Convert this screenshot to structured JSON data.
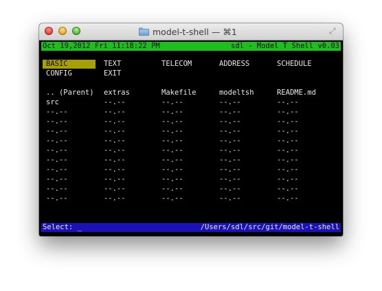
{
  "window": {
    "title": "model-t-shell — ⌘1"
  },
  "top_bar": {
    "datetime": "Oct 19,2012 Fri 11:18:22 PM",
    "app": "sdl - Model T Shell v0.03"
  },
  "menu": [
    [
      "BASIC",
      "TEXT",
      "TELECOM",
      "ADDRESS",
      "SCHEDULE"
    ],
    [
      "CONFIG",
      "EXIT",
      "",
      "",
      ""
    ]
  ],
  "selected_menu": "BASIC",
  "files": [
    [
      ".. (Parent)",
      "extras",
      "Makefile",
      "modeltsh",
      "README.md"
    ],
    [
      "src",
      "--.--",
      "--.--",
      "--.--",
      "--.--"
    ],
    [
      "--.--",
      "--.--",
      "--.--",
      "--.--",
      "--.--"
    ],
    [
      "--.--",
      "--.--",
      "--.--",
      "--.--",
      "--.--"
    ],
    [
      "--.--",
      "--.--",
      "--.--",
      "--.--",
      "--.--"
    ],
    [
      "--.--",
      "--.--",
      "--.--",
      "--.--",
      "--.--"
    ],
    [
      "--.--",
      "--.--",
      "--.--",
      "--.--",
      "--.--"
    ],
    [
      "--.--",
      "--.--",
      "--.--",
      "--.--",
      "--.--"
    ],
    [
      "--.--",
      "--.--",
      "--.--",
      "--.--",
      "--.--"
    ],
    [
      "--.--",
      "--.--",
      "--.--",
      "--.--",
      "--.--"
    ],
    [
      "--.--",
      "--.--",
      "--.--",
      "--.--",
      "--.--"
    ],
    [
      "--.--",
      "--.--",
      "--.--",
      "--.--",
      "--.--"
    ]
  ],
  "status_bar": {
    "prompt": "Select: _",
    "path": "/Users/sdl/src/git/model-t-shell"
  },
  "colors": {
    "top_bar": "#1cbf1c",
    "status_bar": "#1a12b8",
    "selection": "#a8a000"
  }
}
